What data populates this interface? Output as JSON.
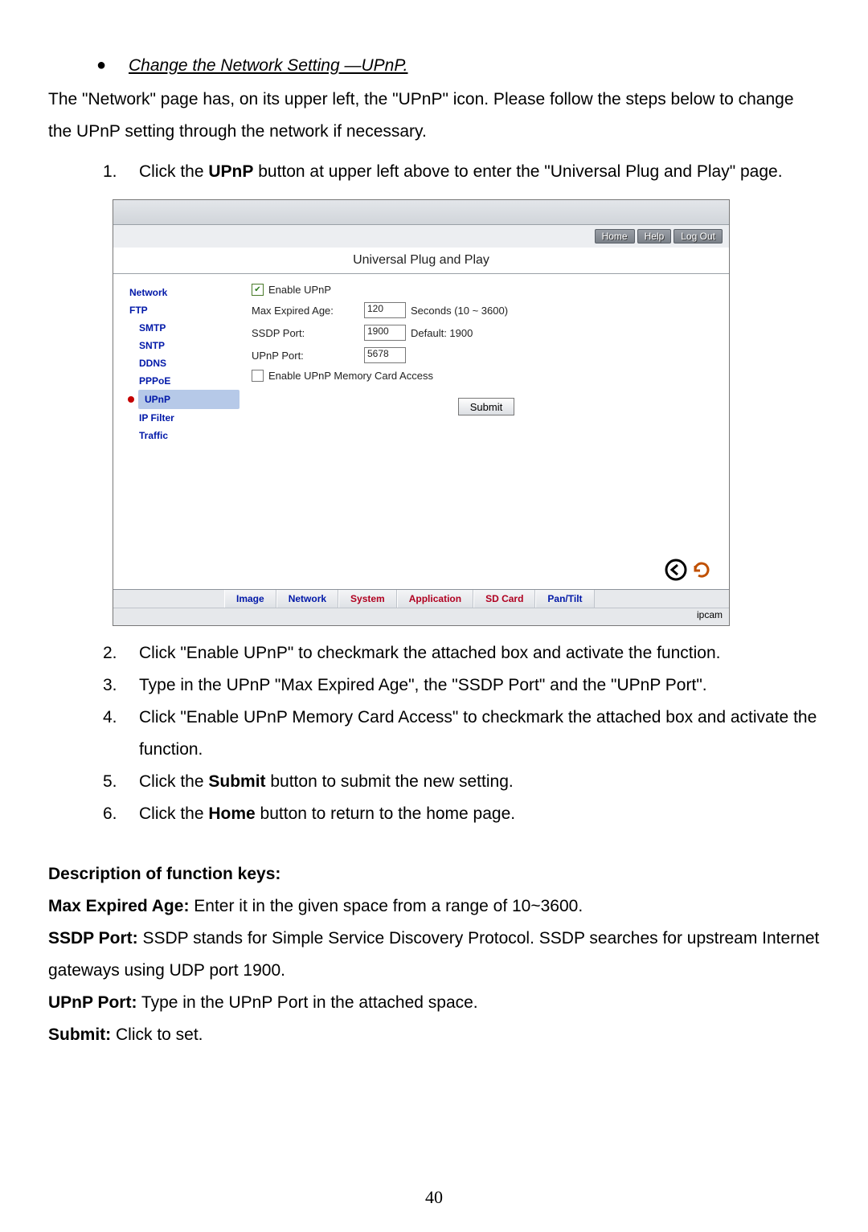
{
  "doc": {
    "bullet_title": "Change the Network Setting —UPnP.",
    "intro": "The \"Network\" page has, on its upper left, the \"UPnP\" icon. Please follow the steps below to change the UPnP setting through the network if necessary.",
    "steps": {
      "s1a": "Click the ",
      "s1b": "UPnP",
      "s1c": " button at upper left above to enter the \"Universal Plug and Play\" page.",
      "s2": "Click \"Enable UPnP\" to checkmark the attached box and activate the function.",
      "s3": "Type in the UPnP \"Max Expired Age\", the \"SSDP Port\" and the \"UPnP Port\".",
      "s4": "Click \"Enable UPnP Memory Card Access\" to checkmark the attached box and activate the function.",
      "s5a": "Click the ",
      "s5b": "Submit",
      "s5c": " button to submit the new setting.",
      "s6a": "Click the ",
      "s6b": "Home",
      "s6c": " button to return to the home page."
    },
    "desc_heading": "Description of function keys:",
    "k1a": "Max Expired Age:",
    "k1b": " Enter it in the given space from a range of 10~3600.",
    "k2a": "SSDP Port:",
    "k2b": " SSDP stands for Simple Service Discovery Protocol. SSDP searches for upstream Internet gateways using UDP port 1900.",
    "k3a": "UPnP Port:",
    "k3b": " Type in the UPnP Port in the attached space.",
    "k4a": "Submit:",
    "k4b": " Click to set.",
    "page_number": "40"
  },
  "shot": {
    "top": {
      "home": "Home",
      "help": "Help",
      "logout": "Log Out"
    },
    "page_title": "Universal Plug and Play",
    "sidebar": {
      "network": "Network",
      "ftp": "FTP",
      "smtp": "SMTP",
      "sntp": "SNTP",
      "ddns": "DDNS",
      "pppoe": "PPPoE",
      "upnp": "UPnP",
      "ipfilter": "IP Filter",
      "traffic": "Traffic"
    },
    "form": {
      "enable_label": "Enable UPnP",
      "max_label": "Max Expired Age:",
      "max_value": "120",
      "max_after": "Seconds (10 ~ 3600)",
      "ssdp_label": "SSDP Port:",
      "ssdp_value": "1900",
      "ssdp_after": "Default: 1900",
      "upnp_label": "UPnP Port:",
      "upnp_value": "5678",
      "mem_label": "Enable UPnP Memory Card Access",
      "submit": "Submit"
    },
    "tabs": {
      "image": "Image",
      "network": "Network",
      "system": "System",
      "application": "Application",
      "sdcard": "SD Card",
      "pantilt": "Pan/Tilt"
    },
    "footer": "ipcam"
  }
}
